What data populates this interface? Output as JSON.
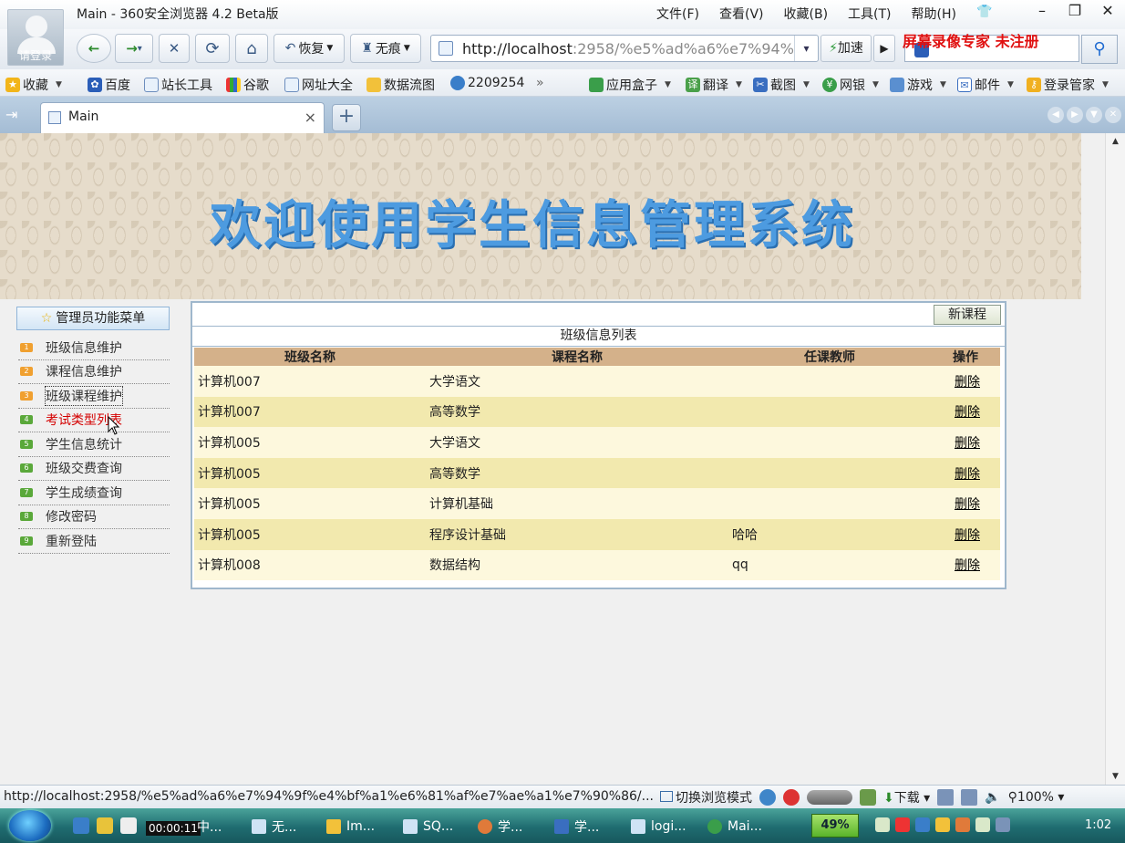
{
  "browser": {
    "login_label": "请登录",
    "window_title": "Main - 360安全浏览器 4.2 Beta版",
    "menu": [
      "文件(F)",
      "查看(V)",
      "收藏(B)",
      "工具(T)",
      "帮助(H)"
    ],
    "win_controls": {
      "minimize": "–",
      "restore": "❐",
      "close": "✕"
    },
    "nav": {
      "back": "←",
      "forward": "→",
      "forward_drop": "▾",
      "stop": "✕",
      "refresh": "⟳",
      "home": "⌂",
      "restore_label": "恢复",
      "private_label": "无痕"
    },
    "address": {
      "host": "http://localhost",
      "path": ":2958/%e5%ad%a6%e7%94%",
      "drop": "▾"
    },
    "speedup_label": "加速",
    "go_label": "▶",
    "search_icon": "search-icon",
    "watermark": "屏幕录像专家  未注册"
  },
  "bookmarks": {
    "fav_label": "收藏",
    "items": [
      "百度",
      "站长工具",
      "谷歌",
      "网址大全",
      "数据流图",
      "2209254"
    ],
    "more": "»",
    "tools": [
      "应用盒子",
      "翻译",
      "截图",
      "网银",
      "游戏",
      "邮件",
      "登录管家"
    ]
  },
  "tabs": {
    "side_toggle": "⇥",
    "active_tab": "Main",
    "close": "×",
    "new_tab": "+"
  },
  "page": {
    "banner_title": "欢迎使用学生信息管理系统",
    "sidebar": {
      "header": "管理员功能菜单",
      "items": [
        {
          "num": "1",
          "label": "班级信息维护"
        },
        {
          "num": "2",
          "label": "课程信息维护"
        },
        {
          "num": "3",
          "label": "班级课程维护"
        },
        {
          "num": "4",
          "label": "考试类型列表"
        },
        {
          "num": "5",
          "label": "学生信息统计"
        },
        {
          "num": "6",
          "label": "班级交费查询"
        },
        {
          "num": "7",
          "label": "学生成绩查询"
        },
        {
          "num": "8",
          "label": "修改密码"
        },
        {
          "num": "9",
          "label": "重新登陆"
        }
      ],
      "colors": {
        "orange": "#f0a030",
        "green": "#5aa83a",
        "active_text": "#d40000"
      }
    },
    "panel": {
      "new_button": "新课程",
      "list_title": "班级信息列表",
      "columns": [
        "班级名称",
        "课程名称",
        "任课教师",
        "操作"
      ],
      "rows": [
        [
          "计算机007",
          "大学语文",
          "",
          "删除"
        ],
        [
          "计算机007",
          "高等数学",
          "",
          "删除"
        ],
        [
          "计算机005",
          "大学语文",
          "",
          "删除"
        ],
        [
          "计算机005",
          "高等数学",
          "",
          "删除"
        ],
        [
          "计算机005",
          "计算机基础",
          "",
          "删除"
        ],
        [
          "计算机005",
          "程序设计基础",
          "哈哈",
          "删除"
        ],
        [
          "计算机008",
          "数据结构",
          "qq",
          "删除"
        ]
      ]
    }
  },
  "statusbar": {
    "url": "http://localhost:2958/%e5%ad%a6%e7%94%9f%e4%bf%a1%e6%81%af%e7%ae%a1%e7%90%86/...",
    "mode_label": "切换浏览模式",
    "download_label": "下载",
    "zoom": "100%"
  },
  "taskbar": {
    "timer": "00:00:11",
    "tasks": [
      "中...",
      "无...",
      "Im...",
      "SQ...",
      "学...",
      "学...",
      "logi...",
      "Mai..."
    ],
    "mem": "49%",
    "clock": "1:02"
  }
}
